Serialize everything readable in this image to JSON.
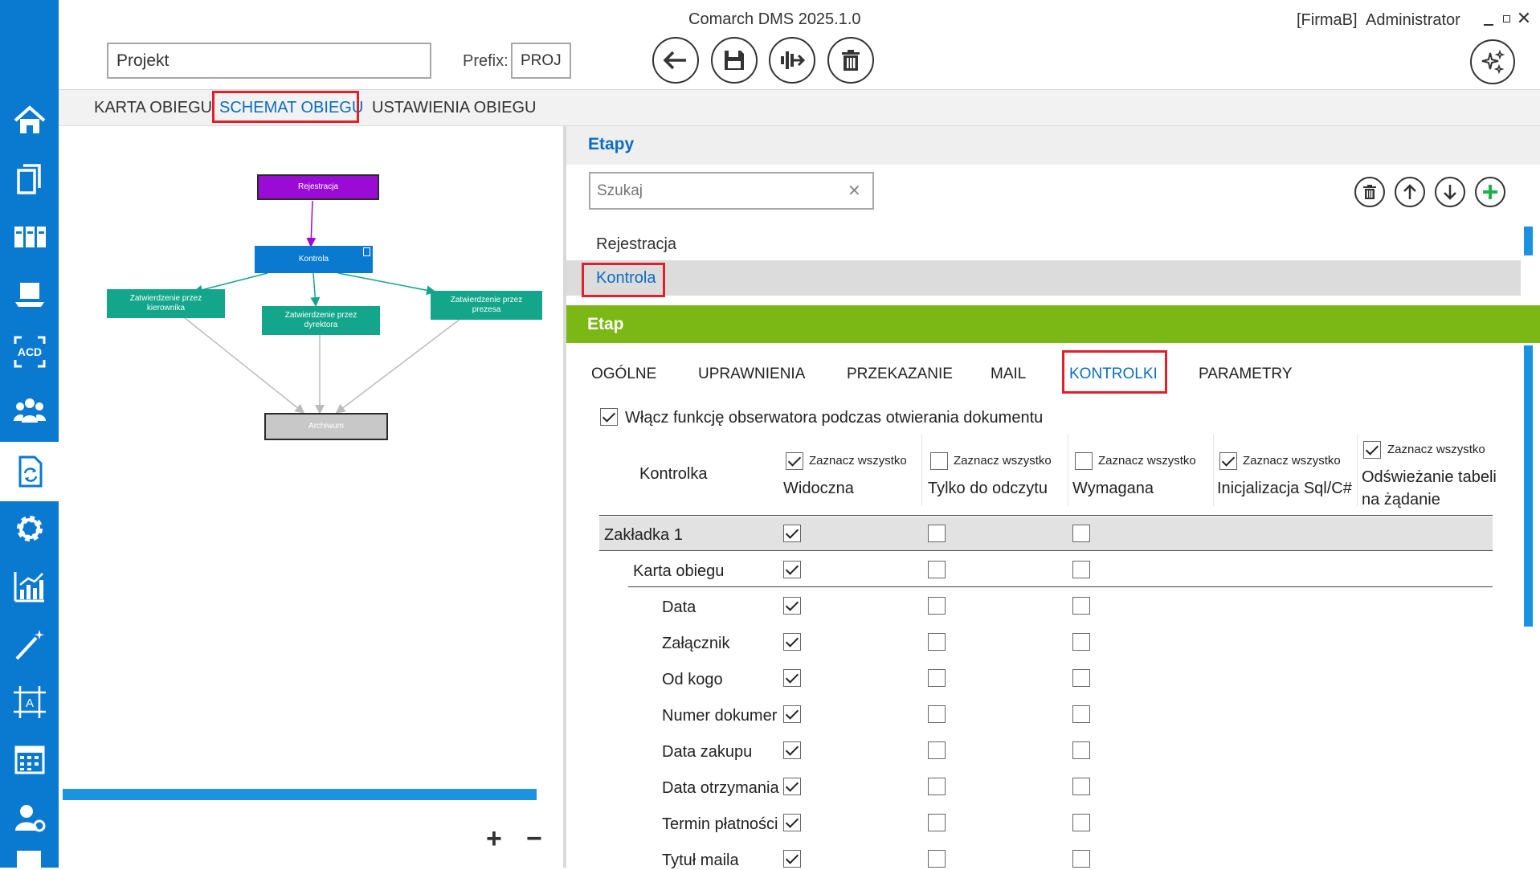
{
  "app": {
    "title": "Comarch DMS 2025.1.0",
    "company": "[FirmaB]",
    "user": "Administrator"
  },
  "header": {
    "name_value": "Projekt",
    "prefix_label": "Prefix:",
    "prefix_value": "PROJ"
  },
  "tabs": [
    {
      "label": "KARTA OBIEGU"
    },
    {
      "label": "SCHEMAT OBIEGU"
    },
    {
      "label": "USTAWIENIA OBIEGU"
    }
  ],
  "diagram": {
    "nodes": {
      "rejestracja": "Rejestracja",
      "kontrola": "Kontrola",
      "kierownik": "Zatwierdzenie przez kierownika",
      "dyrektor": "Zatwierdzenie przez dyrektora",
      "prezes": "Zatwierdzenie przez prezesa",
      "archiwum": "Archiwum"
    },
    "zoom_in": "+",
    "zoom_out": "−"
  },
  "etapy": {
    "title": "Etapy",
    "search_placeholder": "Szukaj",
    "items": [
      "Rejestracja",
      "Kontrola"
    ]
  },
  "etap": {
    "title": "Etap",
    "subtabs": [
      "OGÓLNE",
      "UPRAWNIENIA",
      "PRZEKAZANIE",
      "MAIL",
      "KONTROLKI",
      "PARAMETRY"
    ],
    "observer_label": "Włącz funkcję obserwatora podczas otwierania dokumentu",
    "column_kontrolka": "Kontrolka",
    "select_all": "Zaznacz wszystko",
    "columns": [
      "Widoczna",
      "Tylko do odczytu",
      "Wymagana",
      "Inicjalizacja Sql/C#",
      "Odświeżanie tabeli",
      "na żądanie"
    ],
    "rows": [
      "Zakładka 1",
      "Karta obiegu",
      "Data",
      "Załącznik",
      "Od kogo",
      "Numer dokumer",
      "Data zakupu",
      "Data otrzymania",
      "Termin płatności",
      "Tytuł maila"
    ]
  },
  "colors": {
    "nav": "#0a7ad1",
    "accent_green": "#7cb815",
    "rejestracja": "#9b0bd6",
    "kontrola": "#0a7ad1",
    "approve": "#13a68a",
    "archiwum": "#c8c8c8"
  }
}
